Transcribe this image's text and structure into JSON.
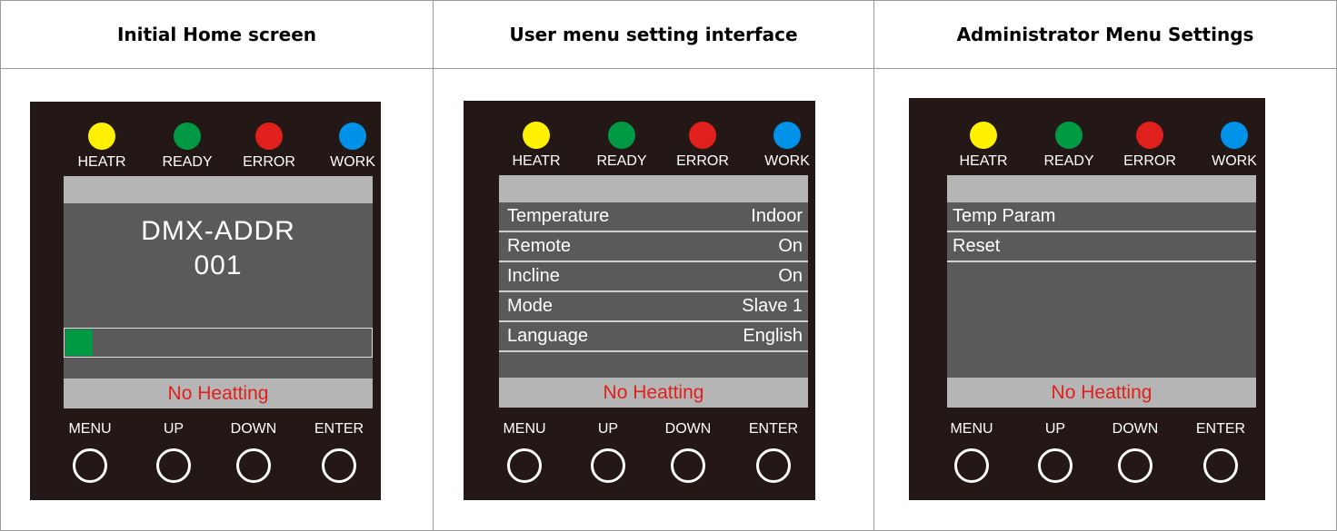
{
  "columns": [
    {
      "header": "Initial Home screen",
      "leds": [
        "HEATR",
        "READY",
        "ERROR",
        "WORK"
      ],
      "screen": {
        "title": "DMX-ADDR",
        "value": "001",
        "progress": 0.09,
        "status": "No Heatting"
      },
      "buttons": [
        "MENU",
        "UP",
        "DOWN",
        "ENTER"
      ]
    },
    {
      "header": "User menu setting interface",
      "leds": [
        "HEATR",
        "READY",
        "ERROR",
        "WORK"
      ],
      "screen": {
        "menu": [
          {
            "label": "Temperature",
            "value": "Indoor"
          },
          {
            "label": "Remote",
            "value": "On"
          },
          {
            "label": "Incline",
            "value": "On"
          },
          {
            "label": "Mode",
            "value": "Slave 1"
          },
          {
            "label": "Language",
            "value": "English"
          }
        ],
        "status": "No Heatting"
      },
      "buttons": [
        "MENU",
        "UP",
        "DOWN",
        "ENTER"
      ]
    },
    {
      "header": "Administrator Menu Settings",
      "leds": [
        "HEATR",
        "READY",
        "ERROR",
        "WORK"
      ],
      "screen": {
        "menu": [
          {
            "label": "Temp Param"
          },
          {
            "label": "Reset"
          }
        ],
        "status": "No Heatting"
      },
      "buttons": [
        "MENU",
        "UP",
        "DOWN",
        "ENTER"
      ]
    }
  ],
  "colors": {
    "panel": "#231815",
    "led_heatr": "#fff100",
    "led_ready": "#009944",
    "led_error": "#e0201c",
    "led_work": "#0091e8",
    "screen_bg": "#5a5a5a",
    "bar_bg": "#b5b5b5",
    "status_text": "#e0201c",
    "progress_fill": "#009944"
  }
}
